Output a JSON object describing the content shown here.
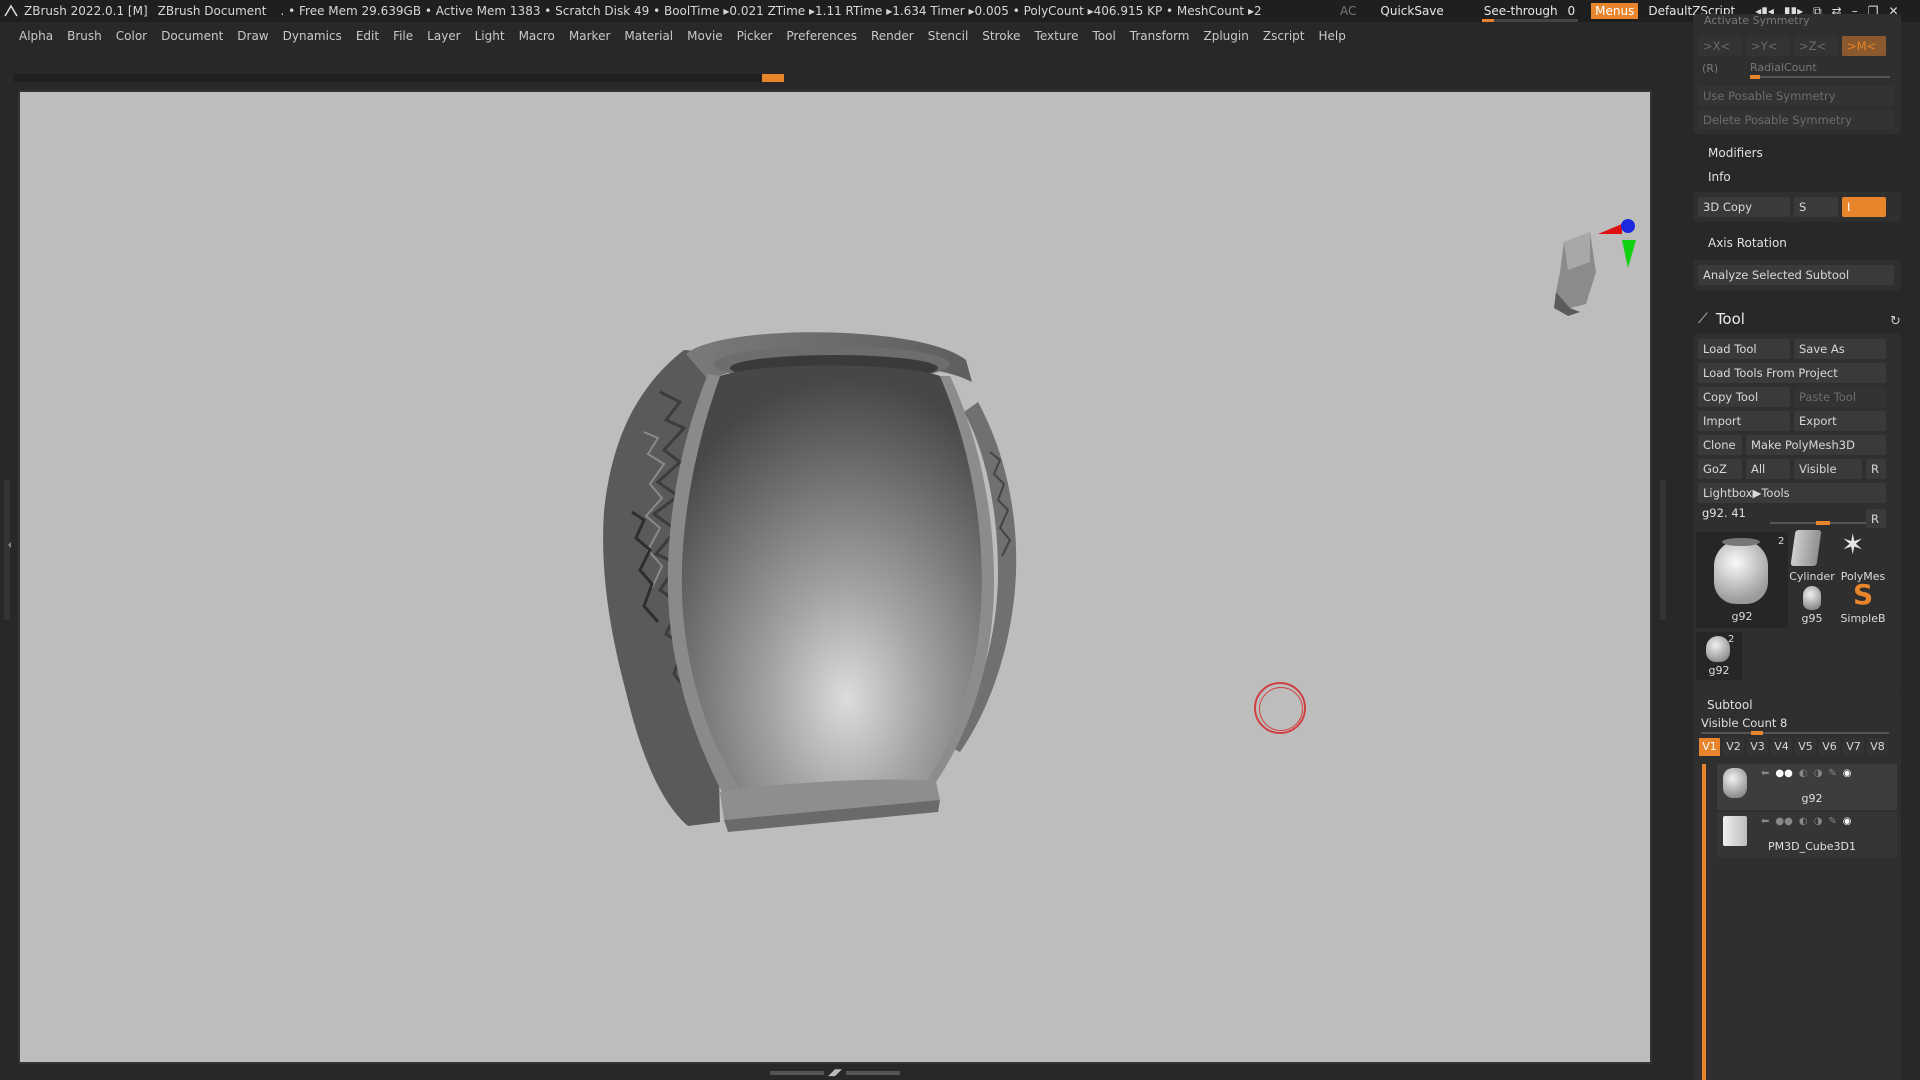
{
  "titlebar": {
    "app": "ZBrush 2022.0.1 [M]",
    "document": "ZBrush Document",
    "stats": ". • Free Mem 29.639GB • Active Mem 1383 • Scratch Disk 49 •  BoolTime ▸0.021 ZTime ▸1.11 RTime ▸1.634 Timer ▸0.005 • PolyCount ▸406.915 KP  • MeshCount ▸2",
    "ac": "AC",
    "quicksave": "QuickSave",
    "seethrough_label": "See-through",
    "seethrough_value": "0",
    "menus": "Menus",
    "script": "DefaultZScript"
  },
  "menubar": [
    "Alpha",
    "Brush",
    "Color",
    "Document",
    "Draw",
    "Dynamics",
    "Edit",
    "File",
    "Layer",
    "Light",
    "Macro",
    "Marker",
    "Material",
    "Movie",
    "Picker",
    "Preferences",
    "Render",
    "Stencil",
    "Stroke",
    "Texture",
    "Tool",
    "Transform",
    "Zplugin",
    "Zscript",
    "Help"
  ],
  "symmetry": {
    "heading": "Activate Symmetry",
    "x": ">X<",
    "y": ">Y<",
    "z": ">Z<",
    "m": ">M<",
    "r": "(R)",
    "radial": "RadialCount",
    "use_posable": "Use Posable Symmetry",
    "delete_posable": "Delete Posable Symmetry"
  },
  "sections": {
    "modifiers": "Modifiers",
    "info": "Info",
    "copy3d": "3D Copy",
    "s": "S",
    "i": "I",
    "axis_rotation": "Axis Rotation",
    "analyze": "Analyze Selected Subtool"
  },
  "tool": {
    "title": "Tool",
    "load": "Load Tool",
    "save_as": "Save As",
    "load_project": "Load Tools From Project",
    "copy": "Copy Tool",
    "paste": "Paste Tool",
    "import": "Import",
    "export": "Export",
    "clone": "Clone",
    "make_polymesh": "Make PolyMesh3D",
    "goz": "GoZ",
    "all": "All",
    "visible": "Visible",
    "r": "R",
    "lightbox": "Lightbox▶Tools",
    "current": "g92. 41",
    "thumbs": {
      "main": "g92",
      "main_badge": "2",
      "cylinder": "Cylinder",
      "polymesh": "PolyMes",
      "g95": "g95",
      "simpleb": "SimpleB",
      "g92b": "g92",
      "g92b_badge": "2"
    }
  },
  "subtool": {
    "title": "Subtool",
    "visible_count": "Visible Count 8",
    "vtabs": [
      "V1",
      "V2",
      "V3",
      "V4",
      "V5",
      "V6",
      "V7",
      "V8"
    ],
    "items": [
      {
        "name": "g92"
      },
      {
        "name": "PM3D_Cube3D1"
      }
    ]
  }
}
